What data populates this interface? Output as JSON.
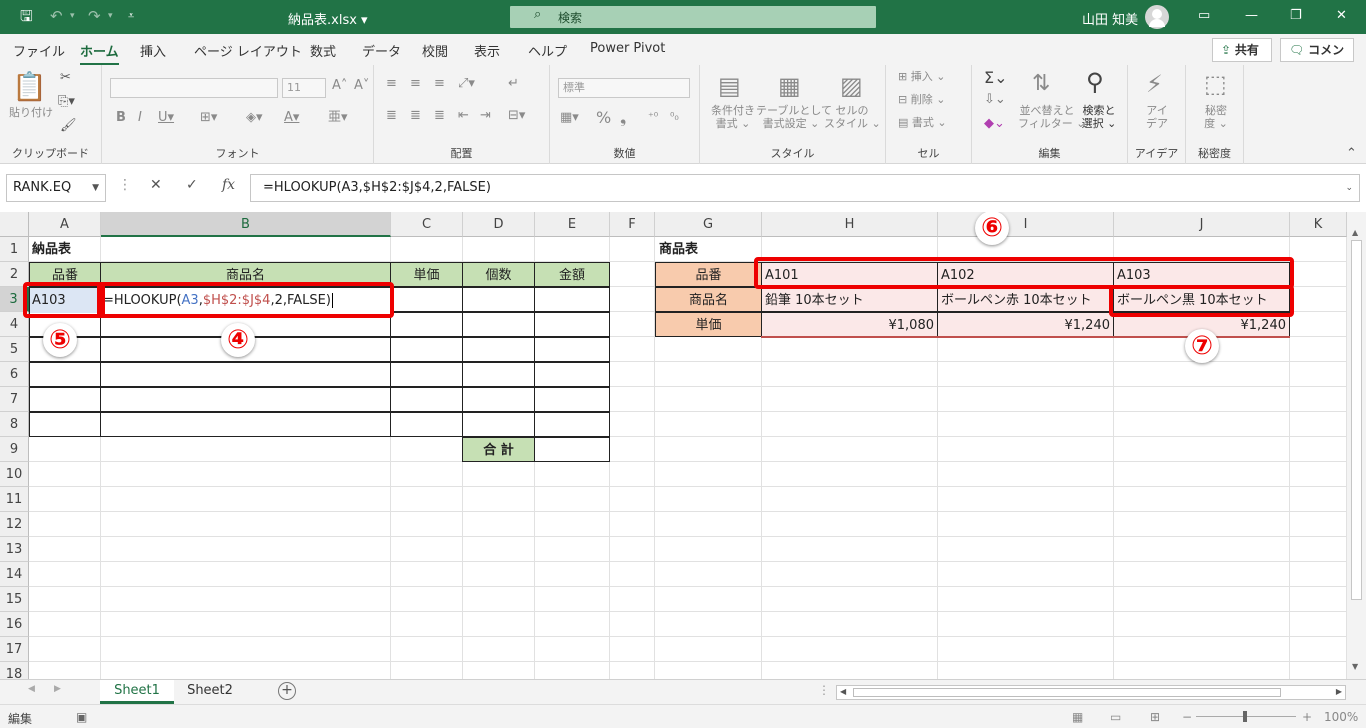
{
  "titlebar": {
    "doc": "納品表.xlsx ▾",
    "search_placeholder": "検索",
    "user": "山田 知美"
  },
  "tabs": {
    "file": "ファイル",
    "home": "ホーム",
    "insert": "挿入",
    "layout": "ページ レイアウト",
    "formulas": "数式",
    "data": "データ",
    "review": "校閲",
    "view": "表示",
    "help": "ヘルプ",
    "powerpivot": "Power Pivot"
  },
  "share": "共有",
  "comment": "コメント",
  "ribbon": {
    "clipboard": {
      "label": "クリップボード",
      "paste": "貼り付け"
    },
    "font": {
      "label": "フォント",
      "size": "11"
    },
    "alignment": {
      "label": "配置"
    },
    "number": {
      "label": "数値",
      "format": "標準"
    },
    "styles": {
      "label": "スタイル",
      "cond": "条件付き\n書式 ⌄",
      "table": "テーブルとして\n書式設定 ⌄",
      "cell": "セルの\nスタイル ⌄"
    },
    "cells": {
      "label": "セル",
      "insert": "挿入",
      "delete": "削除",
      "format": "書式"
    },
    "editing": {
      "label": "編集",
      "sort": "並べ替えと\nフィルター ⌄",
      "find": "検索と\n選択 ⌄"
    },
    "ideas": {
      "label": "アイデア",
      "btn": "アイ\nデア"
    },
    "sensitivity": {
      "label": "秘密度",
      "btn": "秘密\n度 ⌄"
    }
  },
  "formulabar": {
    "namebox": "RANK.EQ",
    "formula": "=HLOOKUP(A3,$H$2:$J$4,2,FALSE)"
  },
  "columns": [
    "A",
    "B",
    "C",
    "D",
    "E",
    "F",
    "G",
    "H",
    "I",
    "J",
    "K"
  ],
  "rows": [
    "1",
    "2",
    "3",
    "4",
    "5",
    "6",
    "7",
    "8",
    "9",
    "10",
    "11",
    "12",
    "13",
    "14",
    "15",
    "16",
    "17",
    "18"
  ],
  "sheet": {
    "a1": "納品表",
    "headers": [
      "品番",
      "商品名",
      "単価",
      "個数",
      "金額"
    ],
    "a3": "A103",
    "edit": {
      "eq": "=HLOOKUP(",
      "ref1": "A3",
      "comma1": ",",
      "ref2": "$H$2:$J$4",
      "rest": ",2,FALSE)"
    },
    "total": "合 計",
    "g1": "商品表",
    "g_labels": [
      "品番",
      "商品名",
      "単価"
    ],
    "product_table": {
      "codes": [
        "A101",
        "A102",
        "A103"
      ],
      "names": [
        "鉛筆 10本セット",
        "ボールペン赤 10本セット",
        "ボールペン黒 10本セット"
      ],
      "prices": [
        "¥1,080",
        "¥1,240",
        "¥1,240"
      ]
    }
  },
  "badges": {
    "four": "④",
    "five": "⑤",
    "six": "⑥",
    "seven": "⑦"
  },
  "sheets": [
    "Sheet1",
    "Sheet2"
  ],
  "status": {
    "mode": "編集",
    "zoom": "100%"
  },
  "colors": {
    "accent": "#217346",
    "highlight_red": "#ee0000",
    "header_green": "#c6e0b4",
    "header_orange": "#f8cbad",
    "pink_fill": "#fbe8e8",
    "ref_blue": "#4472c4",
    "ref_red": "#c0504d"
  }
}
